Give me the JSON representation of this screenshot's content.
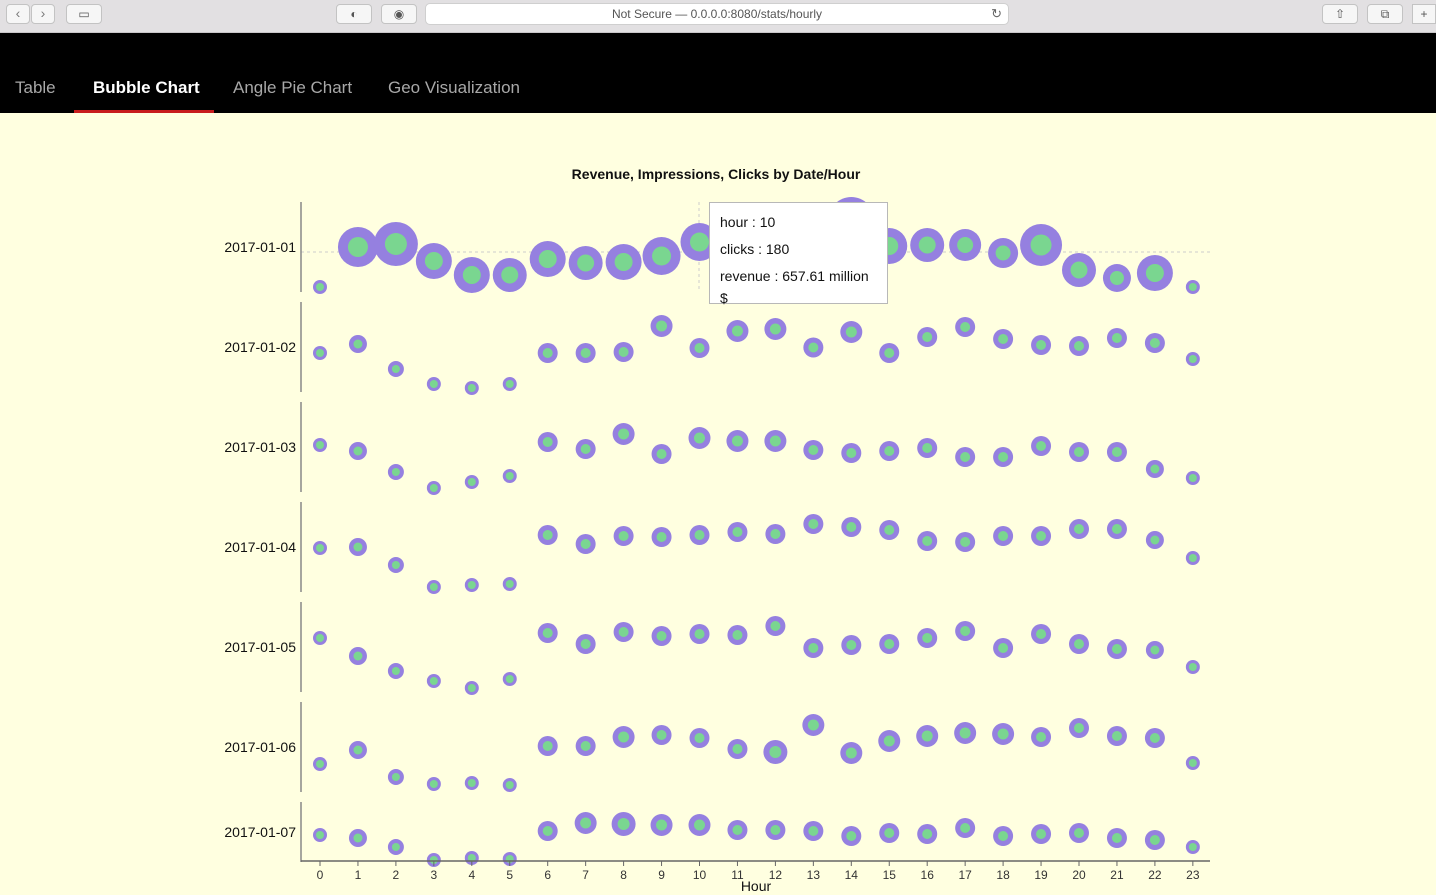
{
  "browser": {
    "address": "Not Secure — 0.0.0.0:8080/stats/hourly"
  },
  "tabs": [
    {
      "label": "Table",
      "active": false
    },
    {
      "label": "Bubble Chart",
      "active": true
    },
    {
      "label": "Angle Pie Chart",
      "active": false
    },
    {
      "label": "Geo Visualization",
      "active": false
    }
  ],
  "colors": {
    "outer": "#9580e0",
    "inner": "#7ad690",
    "accent": "#c81d1d"
  },
  "tooltip": {
    "hour": "hour : 10",
    "clicks": "clicks : 180",
    "revenue": "revenue : 657.61 million $"
  },
  "chart_data": {
    "type": "scatter",
    "title": "Revenue, Impressions, Clicks by Date/Hour",
    "xlabel": "Hour",
    "x": [
      0,
      1,
      2,
      3,
      4,
      5,
      6,
      7,
      8,
      9,
      10,
      11,
      12,
      13,
      14,
      15,
      16,
      17,
      18,
      19,
      20,
      21,
      22,
      23
    ],
    "series": [
      {
        "name": "2017-01-01",
        "size": [
          7,
          20,
          22,
          18,
          18,
          17,
          18,
          17,
          18,
          19,
          19,
          18,
          19,
          19,
          23,
          18,
          17,
          16,
          15,
          21,
          17,
          14,
          18,
          7
        ],
        "y": [
          -40,
          0,
          3,
          -14,
          -28,
          -28,
          -12,
          -16,
          -15,
          -9,
          5,
          2,
          -5,
          -3,
          27,
          1,
          2,
          2,
          -6,
          2,
          -23,
          -31,
          -26,
          -40
        ]
      },
      {
        "name": "2017-01-02",
        "size": [
          7,
          9,
          8,
          7,
          7,
          7,
          10,
          10,
          10,
          11,
          10,
          11,
          11,
          10,
          11,
          10,
          10,
          10,
          10,
          10,
          10,
          10,
          10,
          7
        ],
        "y": [
          -6,
          3,
          -22,
          -37,
          -41,
          -37,
          -6,
          -6,
          -5,
          21,
          -1,
          16,
          18,
          -0.5,
          15,
          -6,
          10,
          20,
          8,
          2,
          1,
          9,
          4,
          -12
        ]
      },
      {
        "name": "2017-01-03",
        "size": [
          7,
          9,
          8,
          7,
          7,
          7,
          10,
          10,
          11,
          10,
          11,
          11,
          11,
          10,
          10,
          10,
          10,
          10,
          10,
          10,
          10,
          10,
          9,
          7
        ],
        "y": [
          2,
          -4,
          -25,
          -41,
          -35,
          -29,
          5,
          -2,
          13,
          -7,
          9,
          6,
          6,
          -3,
          -6,
          -4,
          -1,
          -10,
          -10,
          1,
          -5,
          -5,
          -22,
          -31
        ]
      },
      {
        "name": "2017-01-04",
        "size": [
          7,
          9,
          8,
          7,
          7,
          7,
          10,
          10,
          10,
          10,
          10,
          10,
          10,
          10,
          10,
          10,
          10,
          10,
          10,
          10,
          10,
          10,
          9,
          7
        ],
        "y": [
          -1,
          0,
          -18,
          -40,
          -38,
          -37,
          12,
          3,
          11,
          10,
          12,
          15,
          13,
          23,
          20,
          17,
          6,
          5,
          11,
          11,
          18,
          18,
          7,
          -11
        ]
      },
      {
        "name": "2017-01-05",
        "size": [
          7,
          9,
          8,
          7,
          7,
          7,
          10,
          10,
          10,
          10,
          10,
          10,
          10,
          10,
          10,
          10,
          10,
          10,
          10,
          10,
          10,
          10,
          9,
          7
        ],
        "y": [
          9,
          -9,
          -24,
          -34,
          -41,
          -32,
          14,
          3,
          15,
          11,
          13,
          12,
          21,
          -1,
          2,
          3,
          9,
          16,
          -1,
          13,
          3,
          -2,
          -3,
          -20
        ]
      },
      {
        "name": "2017-01-06",
        "size": [
          7,
          9,
          8,
          7,
          7,
          7,
          10,
          10,
          11,
          10,
          10,
          10,
          12,
          11,
          11,
          11,
          11,
          11,
          11,
          10,
          10,
          10,
          10,
          7
        ],
        "y": [
          -17,
          -3,
          -30,
          -37,
          -36,
          -38,
          1,
          1,
          10,
          12,
          9,
          -2,
          -5,
          22,
          -6,
          6,
          11,
          14,
          13,
          10,
          19,
          11,
          9,
          -16
        ]
      },
      {
        "name": "2017-01-07",
        "size": [
          7,
          9,
          8,
          7,
          7,
          7,
          10,
          11,
          12,
          11,
          11,
          10,
          10,
          10,
          10,
          10,
          10,
          10,
          10,
          10,
          10,
          10,
          10,
          7
        ],
        "y": [
          -3,
          -6,
          -15,
          -28,
          -26,
          -27,
          1,
          9,
          8,
          7,
          7,
          2,
          2,
          1,
          -4,
          -1,
          -2,
          4,
          -4,
          -2,
          -1,
          -6,
          -8,
          -15
        ]
      }
    ]
  }
}
